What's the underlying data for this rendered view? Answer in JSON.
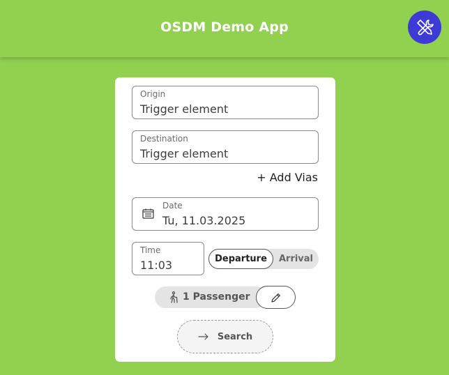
{
  "header": {
    "title": "OSDM Demo App",
    "tools_icon": "tools-icon",
    "background_color": "#92d050",
    "tools_button_color": "#3d3ad6"
  },
  "form": {
    "origin": {
      "label": "Origin",
      "value": "Trigger element"
    },
    "destination": {
      "label": "Destination",
      "value": "Trigger element"
    },
    "add_vias_label": "+ Add Vias",
    "date": {
      "label": "Date",
      "value": "Tu, 11.03.2025",
      "icon": "calendar-icon"
    },
    "time": {
      "label": "Time",
      "value": "11:03"
    },
    "mode_toggle": {
      "departure_label": "Departure",
      "arrival_label": "Arrival",
      "selected": "Departure"
    },
    "passengers": {
      "label": "1 Passenger",
      "icon": "person-walking-icon",
      "edit_icon": "pencil-icon"
    },
    "search": {
      "label": "Search",
      "icon": "arrow-right-icon"
    }
  }
}
